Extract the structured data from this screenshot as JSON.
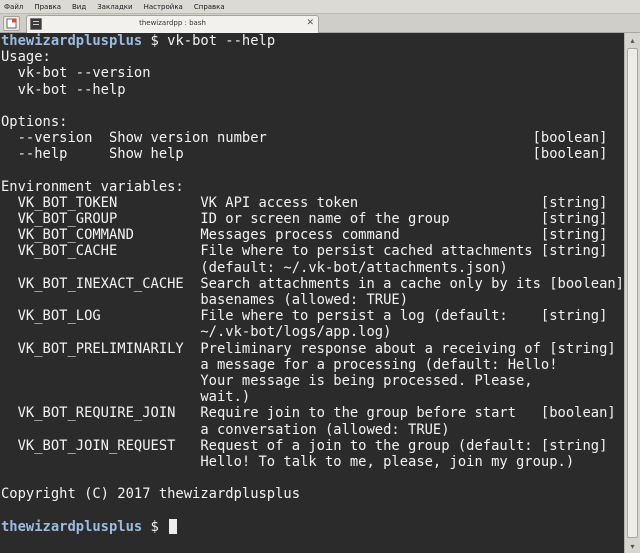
{
  "menu": [
    "Файл",
    "Правка",
    "Вид",
    "Закладки",
    "Настройка",
    "Справка"
  ],
  "tab": {
    "title": "thewizardpp : bash",
    "close": "✕"
  },
  "icons": {
    "new_tab": "new-tab-icon",
    "terminal": "terminal-icon",
    "close": "close-icon"
  },
  "scrollbar": {
    "up": "▴",
    "down": "▾"
  },
  "colors": {
    "background": "#2b2b2b",
    "text": "#f2f2f2",
    "prompt_user": "#9cbbe0"
  },
  "terminal": {
    "prompt_user": "thewizardplusplus",
    "prompt_symbol": "$",
    "command": "vk-bot --help",
    "output": [
      "Usage:",
      "  vk-bot --version",
      "  vk-bot --help",
      "",
      "Options:",
      "  --version  Show version number                                [boolean]",
      "  --help     Show help                                          [boolean]",
      "",
      "Environment variables:",
      "  VK_BOT_TOKEN          VK API access token                      [string]",
      "  VK_BOT_GROUP          ID or screen name of the group           [string]",
      "  VK_BOT_COMMAND        Messages process command                 [string]",
      "  VK_BOT_CACHE          File where to persist cached attachments [string]",
      "                        (default: ~/.vk-bot/attachments.json)",
      "  VK_BOT_INEXACT_CACHE  Search attachments in a cache only by its [boolean]",
      "                        basenames (allowed: TRUE)",
      "  VK_BOT_LOG            File where to persist a log (default:    [string]",
      "                        ~/.vk-bot/logs/app.log)",
      "  VK_BOT_PRELIMINARILY  Preliminary response about a receiving of [string]",
      "                        a message for a processing (default: Hello!",
      "                        Your message is being processed. Please,",
      "                        wait.)",
      "  VK_BOT_REQUIRE_JOIN   Require join to the group before start   [boolean]",
      "                        a conversation (allowed: TRUE)",
      "  VK_BOT_JOIN_REQUEST   Request of a join to the group (default: [string]",
      "                        Hello! To talk to me, please, join my group.)",
      "",
      "Copyright (C) 2017 thewizardplusplus",
      ""
    ],
    "final_prompt_user": "thewizardplusplus",
    "final_prompt_symbol": "$"
  }
}
